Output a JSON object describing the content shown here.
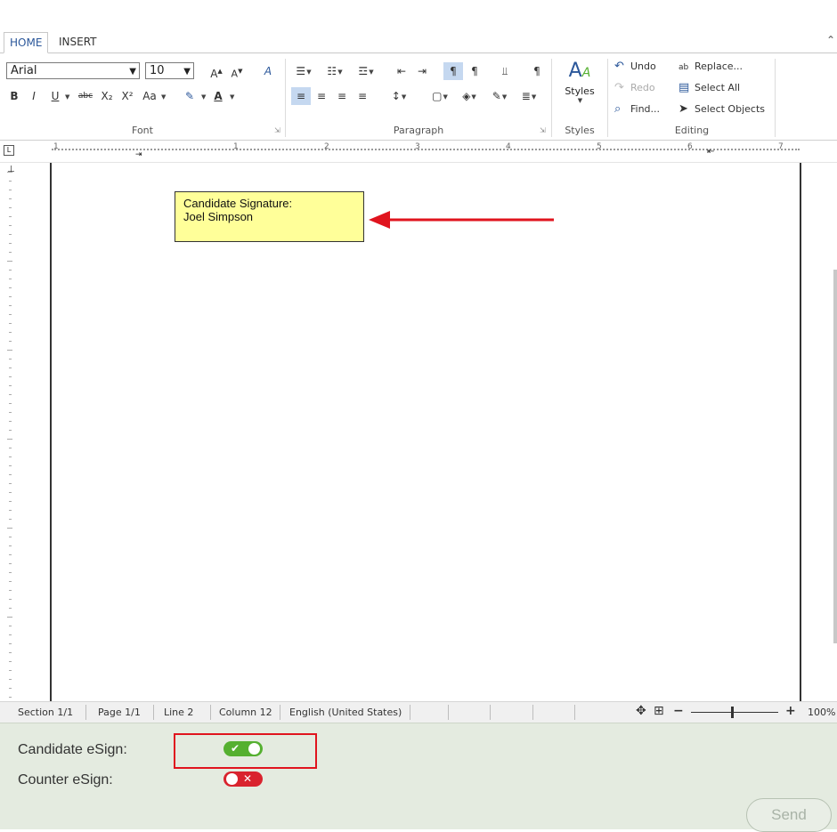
{
  "ribbon": {
    "tabs": [
      "HOME",
      "INSERT"
    ],
    "font": {
      "family": "Arial",
      "size": "10",
      "group_label": "Font",
      "buttons": [
        "B",
        "I",
        "U",
        "abc",
        "X₂",
        "X²",
        "Aa"
      ]
    },
    "paragraph": {
      "group_label": "Paragraph"
    },
    "styles": {
      "label": "Styles",
      "group_label": "Styles"
    },
    "editing": {
      "group_label": "Editing",
      "undo": "Undo",
      "redo": "Redo",
      "find": "Find...",
      "replace": "Replace...",
      "select_all": "Select All",
      "select_objects": "Select Objects"
    }
  },
  "ruler": {
    "numbers": [
      "1",
      "1",
      "2",
      "3",
      "4",
      "5",
      "6",
      "7"
    ]
  },
  "document": {
    "signature_line1": "Candidate Signature:",
    "signature_line2": "Joel Simpson"
  },
  "statusbar": {
    "section": "Section 1/1",
    "page": "Page 1/1",
    "line": "Line 2",
    "column": "Column 12",
    "language": "English (United States)",
    "zoom": "100%"
  },
  "esign": {
    "candidate_label": "Candidate eSign:",
    "candidate_on": true,
    "counter_label": "Counter eSign:",
    "counter_on": false,
    "send_label": "Send"
  },
  "colors": {
    "toggle_on": "#55b030",
    "toggle_off": "#d9232e",
    "annotation_red": "#e0141e",
    "signature_box": "#ffff99"
  }
}
